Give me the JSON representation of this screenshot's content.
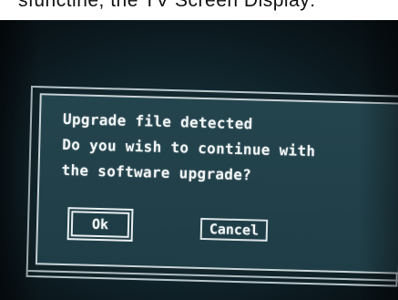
{
  "caption": {
    "text": "sfunctine, the TV Screen Display:"
  },
  "dialog": {
    "lines": [
      "Upgrade file detected",
      "Do you wish to continue with",
      "the software upgrade?"
    ],
    "ok_label": "Ok",
    "cancel_label": "Cancel",
    "selected_button": "Ok"
  },
  "colors": {
    "screen_background": "#12272f",
    "dialog_background": "#1f3d46",
    "dialog_border": "#c8d4d8",
    "text": "#f1f5f6"
  }
}
